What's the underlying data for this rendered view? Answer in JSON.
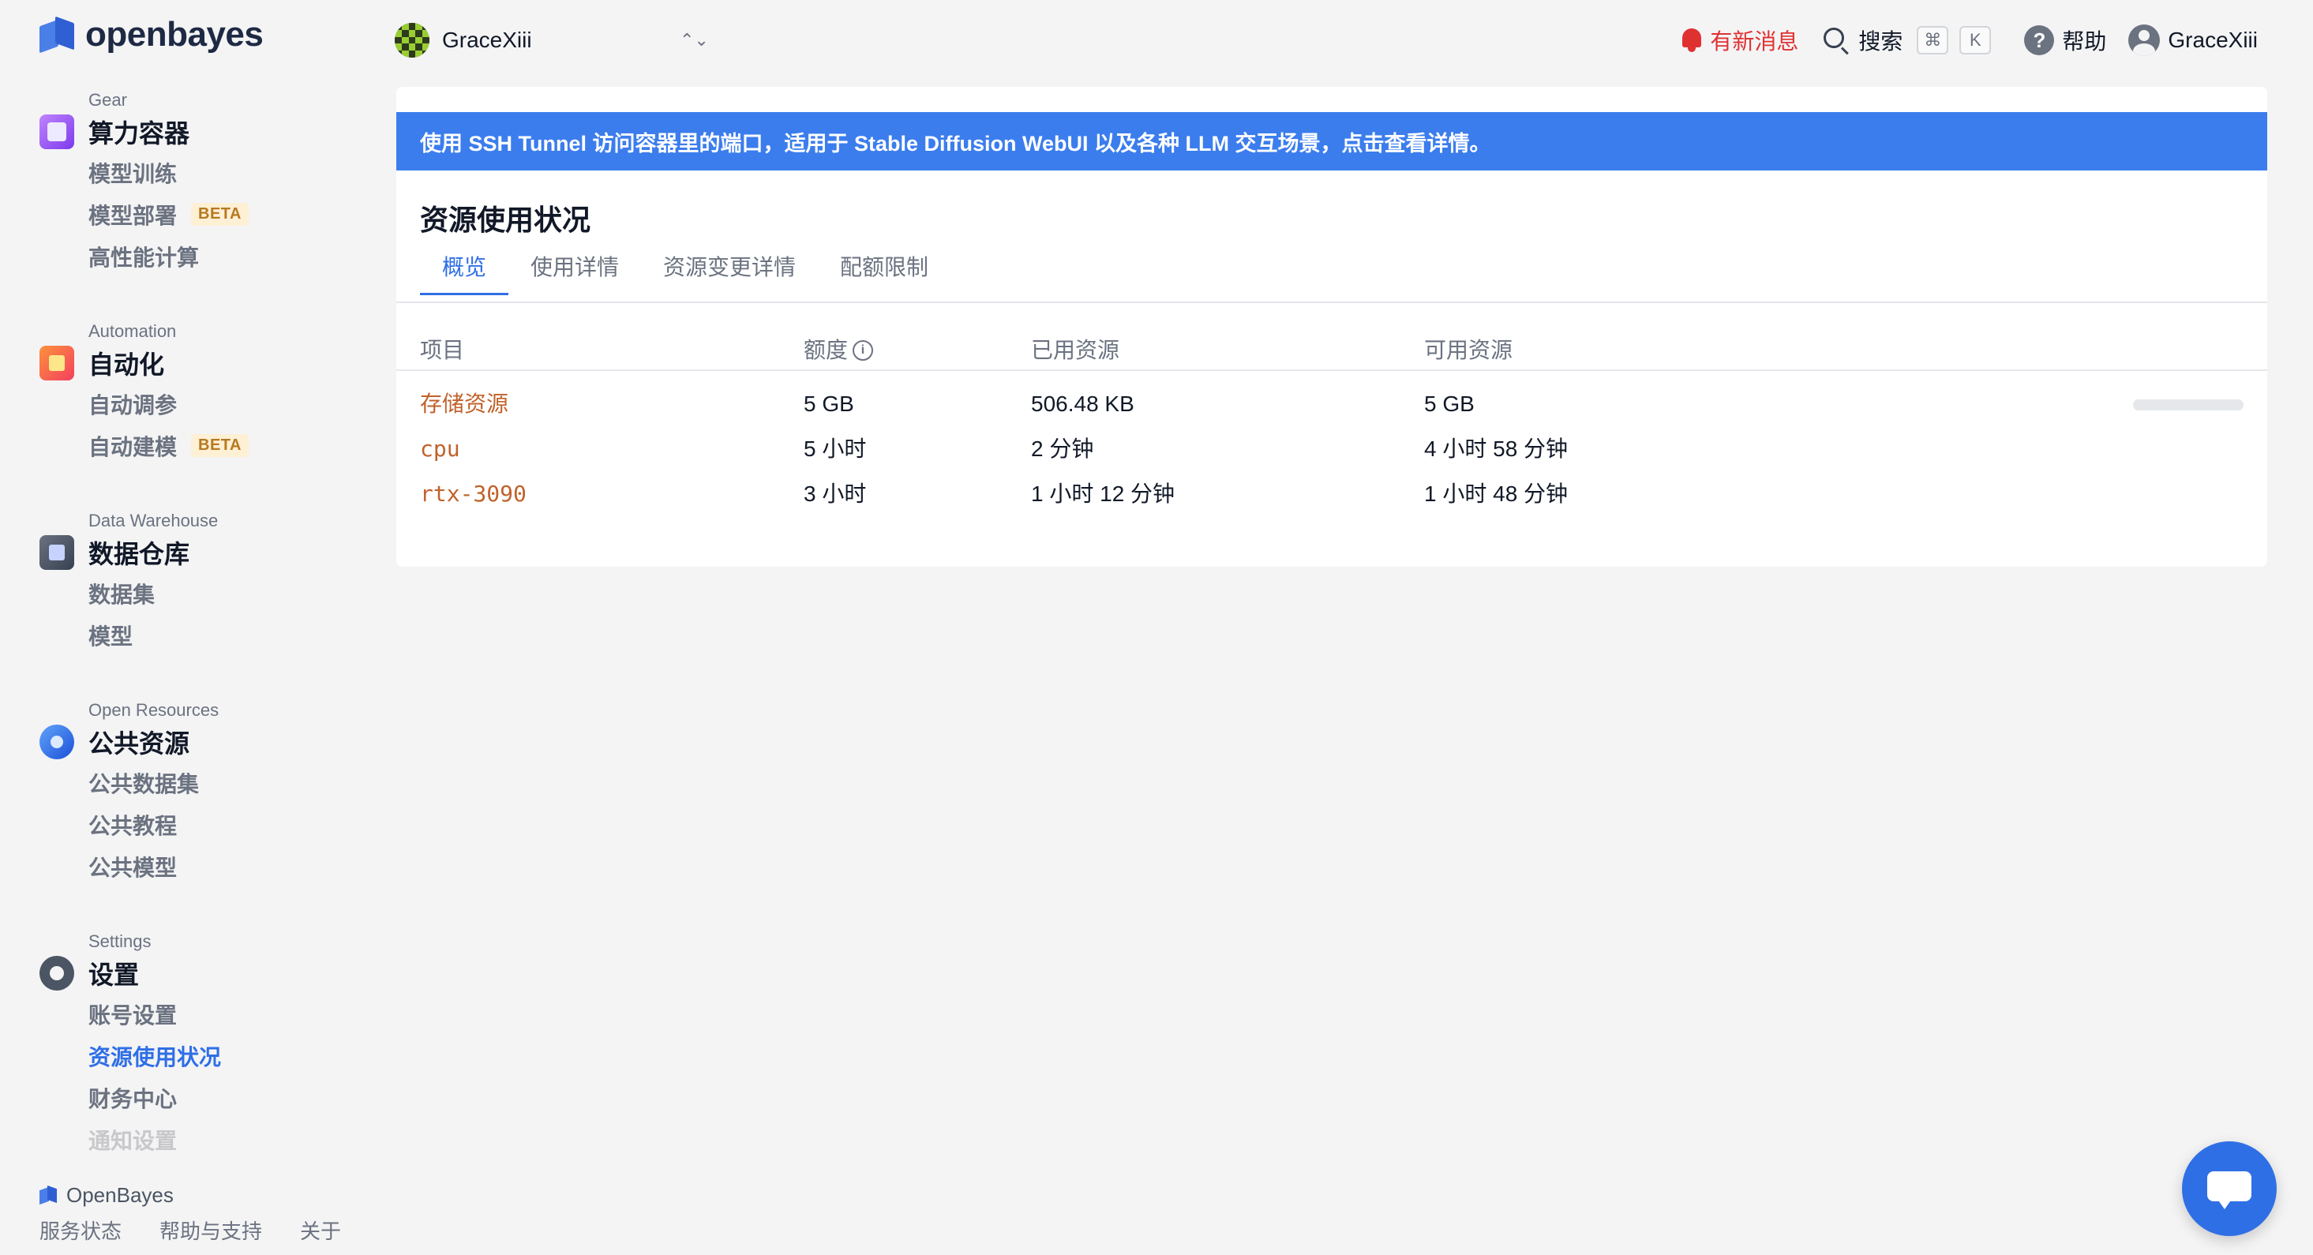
{
  "brand": {
    "name": "openbayes"
  },
  "sidebar": {
    "sections": [
      {
        "id": "gear",
        "subtitle": "Gear",
        "title": "算力容器",
        "icon": "gear-container-icon",
        "items": [
          {
            "label": "模型训练"
          },
          {
            "label": "模型部署",
            "badge": "BETA"
          },
          {
            "label": "高性能计算"
          }
        ]
      },
      {
        "id": "automation",
        "subtitle": "Automation",
        "title": "自动化",
        "icon": "automation-icon",
        "items": [
          {
            "label": "自动调参"
          },
          {
            "label": "自动建模",
            "badge": "BETA"
          }
        ]
      },
      {
        "id": "warehouse",
        "subtitle": "Data Warehouse",
        "title": "数据仓库",
        "icon": "data-warehouse-icon",
        "items": [
          {
            "label": "数据集"
          },
          {
            "label": "模型"
          }
        ]
      },
      {
        "id": "open",
        "subtitle": "Open Resources",
        "title": "公共资源",
        "icon": "open-resources-icon",
        "items": [
          {
            "label": "公共数据集"
          },
          {
            "label": "公共教程"
          },
          {
            "label": "公共模型"
          }
        ]
      },
      {
        "id": "settings",
        "subtitle": "Settings",
        "title": "设置",
        "icon": "settings-gear-icon",
        "items": [
          {
            "label": "账号设置"
          },
          {
            "label": "资源使用状况",
            "active": true
          },
          {
            "label": "财务中心"
          },
          {
            "label": "通知设置"
          }
        ]
      }
    ],
    "footer": {
      "brand": "OpenBayes",
      "links": [
        "服务状态",
        "帮助与支持",
        "关于"
      ]
    }
  },
  "topbar": {
    "workspace": {
      "name": "GraceXiii",
      "toggle": "⌃⌄"
    },
    "notifications_label": "有新消息",
    "search_label": "搜索",
    "search_shortcut": [
      "⌘",
      "K"
    ],
    "help_label": "帮助",
    "user_name": "GraceXiii"
  },
  "main": {
    "banner": "使用 SSH Tunnel 访问容器里的端口，适用于 Stable Diffusion WebUI 以及各种 LLM 交互场景，点击查看详情。",
    "title": "资源使用状况",
    "tabs": [
      {
        "label": "概览",
        "active": true
      },
      {
        "label": "使用详情"
      },
      {
        "label": "资源变更详情"
      },
      {
        "label": "配额限制"
      }
    ],
    "table": {
      "headers": {
        "item": "项目",
        "quota": "额度",
        "used": "已用资源",
        "available": "可用资源"
      },
      "rows": [
        {
          "item": "存储资源",
          "quota": "5 GB",
          "used": "506.48 KB",
          "available": "5 GB",
          "progress": 0.0001
        },
        {
          "item": "cpu",
          "quota": "5 小时",
          "used": "2 分钟",
          "available": "4 小时 58 分钟"
        },
        {
          "item": "rtx-3090",
          "quota": "3 小时",
          "used": "1 小时 12 分钟",
          "available": "1 小时 48 分钟"
        }
      ]
    }
  },
  "colors": {
    "accent": "#2f6fe6",
    "banner": "#3b7ded",
    "alert": "#e03131",
    "item_text": "#c0622b",
    "beta_badge": "#b7791f"
  }
}
